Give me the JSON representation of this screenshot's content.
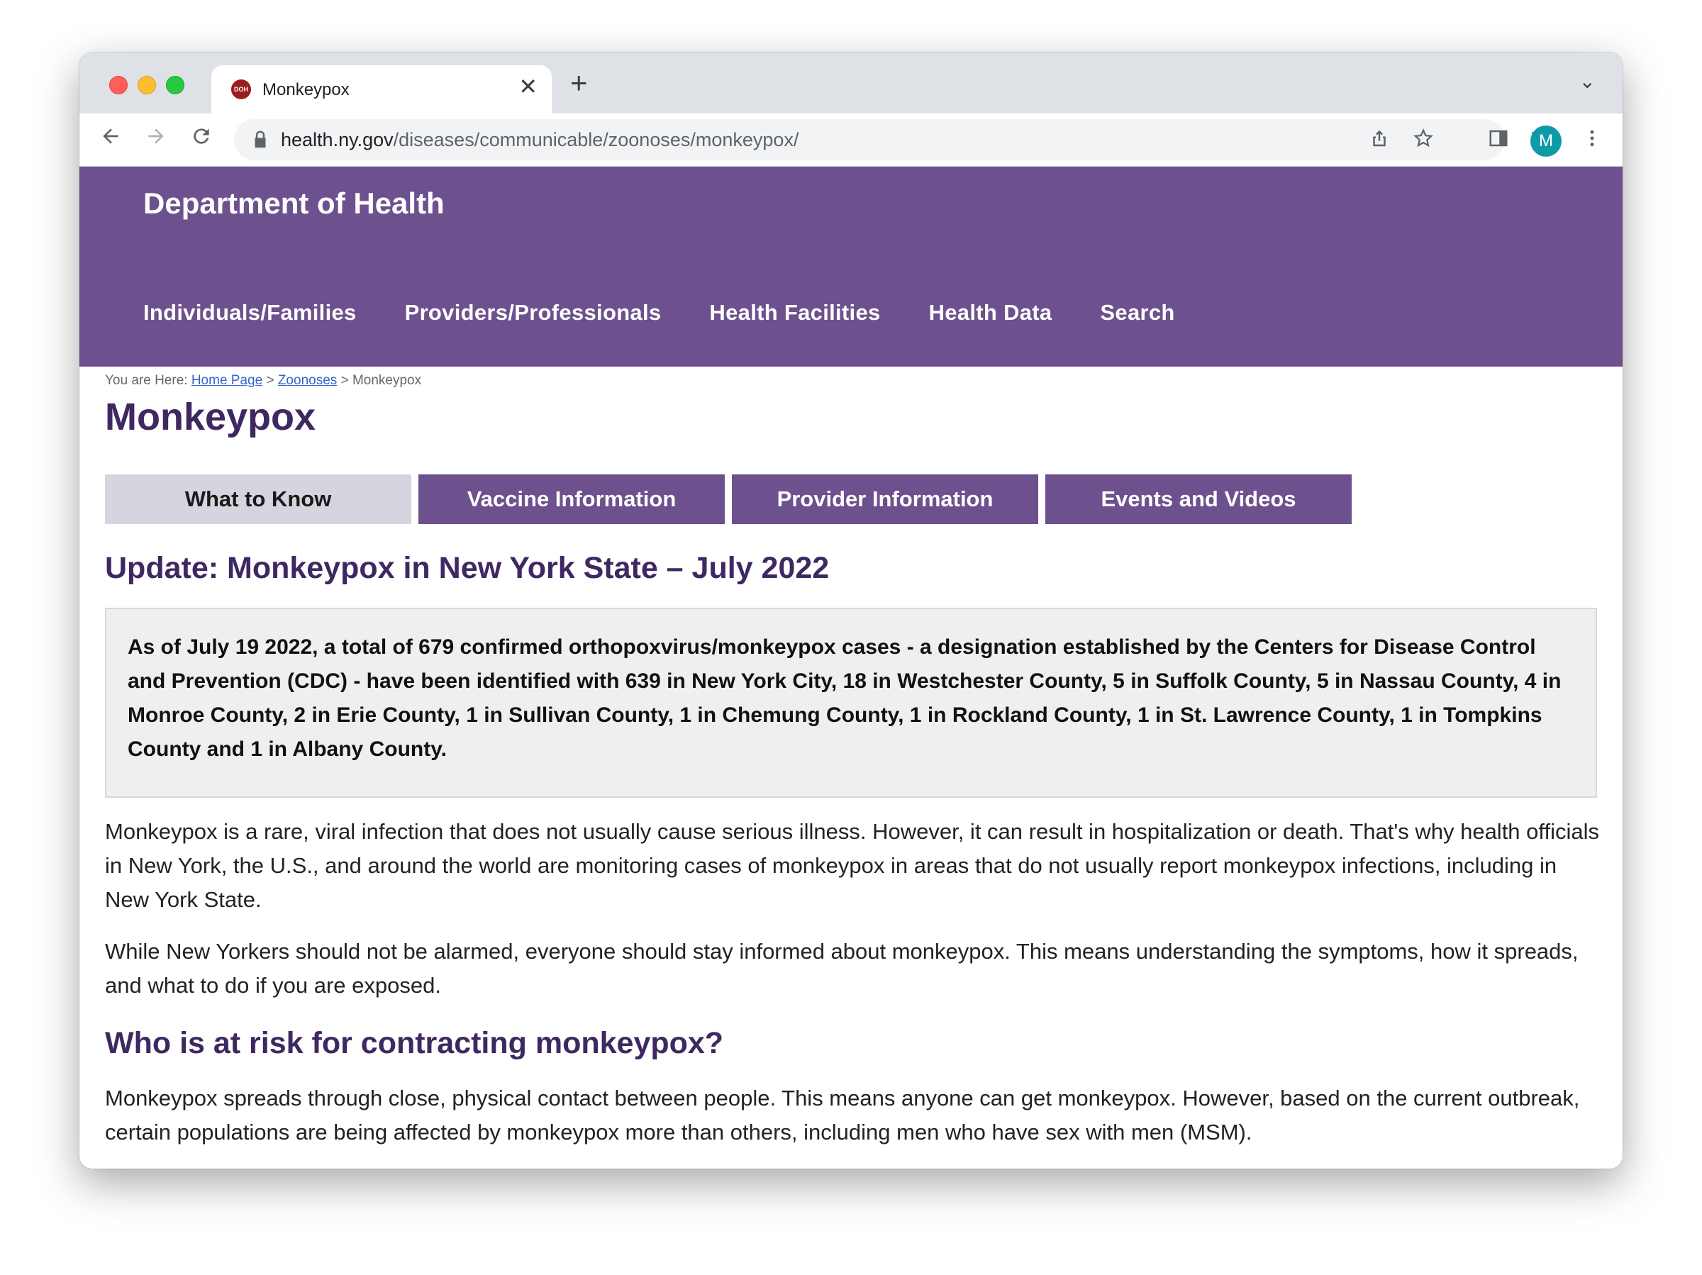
{
  "browser": {
    "tab_title": "Monkeypox",
    "favicon_text": "DOH",
    "close_glyph": "✕",
    "newtab_glyph": "+",
    "tabmenu_glyph": "⌄",
    "url_host": "health.ny.gov",
    "url_path": "/diseases/communicable/zoonoses/monkeypox/",
    "avatar_letter": "M"
  },
  "site": {
    "brand": "Department of Health",
    "nav": [
      "Individuals/Families",
      "Providers/Professionals",
      "Health Facilities",
      "Health Data",
      "Search"
    ]
  },
  "breadcrumb": {
    "prefix": "You are Here: ",
    "home": "Home Page",
    "sep1": " > ",
    "zoonoses": "Zoonoses",
    "sep2": " > ",
    "current": "Monkeypox"
  },
  "page": {
    "title": "Monkeypox",
    "tabs": [
      "What to Know",
      "Vaccine Information",
      "Provider Information",
      "Events and Videos"
    ],
    "update_heading": "Update: Monkeypox in New York State – July 2022",
    "callout": "As of July 19 2022, a total of 679 confirmed orthopoxvirus/monkeypox cases - a designation established by the Centers for Disease Control and Prevention (CDC) - have been identified with 639 in New York City, 18 in Westchester County, 5 in Suffolk County, 5 in Nassau County, 4 in Monroe County, 2 in Erie County, 1 in Sullivan County, 1 in Chemung County, 1 in Rockland County, 1 in St. Lawrence County, 1 in Tompkins County and 1 in Albany County.",
    "para1": "Monkeypox is a rare, viral infection that does not usually cause serious illness. However, it can result in hospitalization or death. That's why health officials in New York, the U.S., and around the world are monitoring cases of monkeypox in areas that do not usually report monkeypox infections, including in New York State.",
    "para2": "While New Yorkers should not be alarmed, everyone should stay informed about monkeypox. This means understanding the symptoms, how it spreads, and what to do if you are exposed.",
    "risk_heading": "Who is at risk for contracting monkeypox?",
    "para3": "Monkeypox spreads through close, physical contact between people. This means anyone can get monkeypox. However, based on the current outbreak, certain populations are being affected by monkeypox more than others, including men who have sex with men (MSM)."
  },
  "colors": {
    "brand_purple": "#6d518e",
    "heading_purple": "#3f2862",
    "active_tab": "#d5d5df"
  }
}
